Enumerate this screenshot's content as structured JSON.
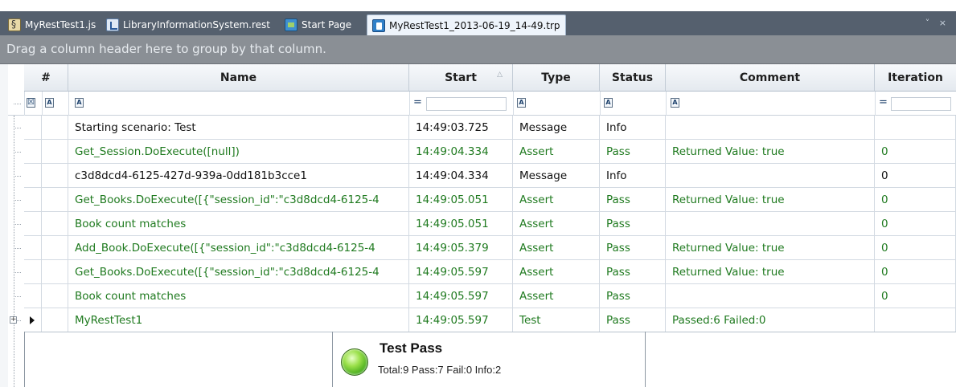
{
  "tabs": [
    {
      "label": "MyRestTest1.js",
      "icon": "script-file-icon"
    },
    {
      "label": "LibraryInformationSystem.rest",
      "icon": "rest-file-icon"
    },
    {
      "label": "Start Page",
      "icon": "start-page-icon"
    },
    {
      "label": "MyRestTest1_2013-06-19_14-49.trp",
      "icon": "test-result-file-icon",
      "active": true
    }
  ],
  "strip_controls": "˅ ×",
  "group_panel": {
    "text": "Drag a column header here to group by that column."
  },
  "columns": [
    {
      "label": "#"
    },
    {
      "label": "Name"
    },
    {
      "label": "Start",
      "sort": "△"
    },
    {
      "label": "Type"
    },
    {
      "label": "Status"
    },
    {
      "label": "Comment"
    },
    {
      "label": "Iteration"
    }
  ],
  "filter_row": {
    "text_glyph": "A",
    "eq_glyph": "="
  },
  "rows": [
    {
      "name": "Starting scenario: Test",
      "start": "14:49:03.725",
      "type": "Message",
      "status": "Info",
      "comment": "",
      "iteration": "",
      "tone": "black"
    },
    {
      "name": "Get_Session.DoExecute([null])",
      "start": "14:49:04.334",
      "type": "Assert",
      "status": "Pass",
      "comment": "Returned Value: true",
      "iteration": "0",
      "tone": "green"
    },
    {
      "name": "c3d8dcd4-6125-427d-939a-0dd181b3cce1",
      "start": "14:49:04.334",
      "type": "Message",
      "status": "Info",
      "comment": "",
      "iteration": "0",
      "tone": "black"
    },
    {
      "name": "Get_Books.DoExecute([{\"session_id\":\"c3d8dcd4-6125-4",
      "start": "14:49:05.051",
      "type": "Assert",
      "status": "Pass",
      "comment": "Returned Value: true",
      "iteration": "0",
      "tone": "green"
    },
    {
      "name": "Book count matches",
      "start": "14:49:05.051",
      "type": "Assert",
      "status": "Pass",
      "comment": "",
      "iteration": "0",
      "tone": "green"
    },
    {
      "name": "Add_Book.DoExecute([{\"session_id\":\"c3d8dcd4-6125-4",
      "start": "14:49:05.379",
      "type": "Assert",
      "status": "Pass",
      "comment": "Returned Value: true",
      "iteration": "0",
      "tone": "green"
    },
    {
      "name": "Get_Books.DoExecute([{\"session_id\":\"c3d8dcd4-6125-4",
      "start": "14:49:05.597",
      "type": "Assert",
      "status": "Pass",
      "comment": "Returned Value: true",
      "iteration": "0",
      "tone": "green"
    },
    {
      "name": "Book count matches",
      "start": "14:49:05.597",
      "type": "Assert",
      "status": "Pass",
      "comment": "",
      "iteration": "0",
      "tone": "green"
    },
    {
      "name": "MyRestTest1",
      "start": "14:49:05.597",
      "type": "Test",
      "status": "Pass",
      "comment": "Passed:6 Failed:0",
      "iteration": "",
      "tone": "green"
    }
  ],
  "summary": {
    "title": "Test Pass",
    "stats": "Total:9 Pass:7 Fail:0 Info:2",
    "indicator_color": "#5ccc1f"
  },
  "colors": {
    "pass_text": "#1f7a1f",
    "group_panel": "#8a8f95",
    "tab_bar": "#55606e"
  }
}
